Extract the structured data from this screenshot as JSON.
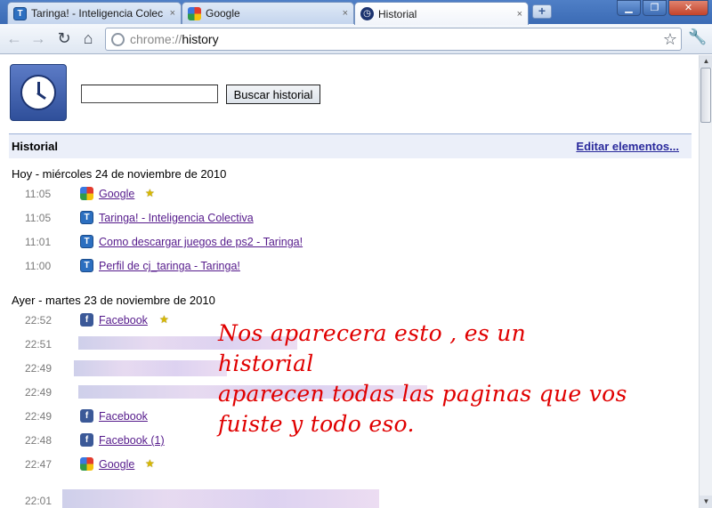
{
  "tabs": [
    {
      "label": "Taringa! - Inteligencia Colec",
      "icon": "taringa-icon",
      "active": false
    },
    {
      "label": "Google",
      "icon": "google-icon",
      "active": false
    },
    {
      "label": "Historial",
      "icon": "clock-icon",
      "active": true
    }
  ],
  "tab_close_glyph": "×",
  "new_tab_glyph": "+",
  "window_controls": {
    "minimize": "▁",
    "maximize": "❐",
    "close": "✕"
  },
  "omnibox": {
    "scheme": "chrome://",
    "host": "history"
  },
  "toolbar_icons": [
    "back-arrow-icon",
    "forward-arrow-icon",
    "reload-icon",
    "home-icon",
    "bookmark-star-icon",
    "wrench-icon"
  ],
  "search": {
    "value": "",
    "button_label": "Buscar historial"
  },
  "section": {
    "title": "Historial",
    "edit_link": "Editar elementos..."
  },
  "days": [
    {
      "heading": "Hoy - miércoles 24 de noviembre de 2010",
      "entries": [
        {
          "time": "11:05",
          "title": "Google",
          "favicon": "google",
          "starred": true
        },
        {
          "time": "11:05",
          "title": "Taringa! - Inteligencia Colectiva",
          "favicon": "taringa",
          "starred": false
        },
        {
          "time": "11:01",
          "title": "Como descargar juegos de ps2 - Taringa!",
          "favicon": "taringa",
          "starred": false
        },
        {
          "time": "11:00",
          "title": "Perfil de cj_taringa - Taringa!",
          "favicon": "taringa",
          "starred": false
        }
      ]
    },
    {
      "heading": "Ayer - martes 23 de noviembre de 2010",
      "entries": [
        {
          "time": "22:52",
          "title": "Facebook",
          "favicon": "facebook",
          "starred": true
        },
        {
          "time": "22:51",
          "title": "",
          "favicon": "blurred",
          "starred": false
        },
        {
          "time": "22:49",
          "title": "",
          "favicon": "blurred",
          "starred": false
        },
        {
          "time": "22:49",
          "title": "",
          "favicon": "blurred",
          "starred": false
        },
        {
          "time": "22:49",
          "title": "Facebook",
          "favicon": "facebook",
          "starred": false
        },
        {
          "time": "22:48",
          "title": "Facebook (1)",
          "favicon": "facebook",
          "starred": false
        },
        {
          "time": "22:47",
          "title": "Google",
          "favicon": "google",
          "starred": true
        },
        {
          "time": "22:01",
          "title": "",
          "favicon": "blurred",
          "starred": false
        }
      ]
    }
  ],
  "annotation": {
    "line1": "Nos aparecera esto , es un historial",
    "line2": "aparecen todas las paginas que vos",
    "line3": "fuiste y todo eso."
  },
  "colors": {
    "annotation": "#e00000",
    "link_visited": "#551a8b",
    "header_bg": "#ebeff9"
  }
}
